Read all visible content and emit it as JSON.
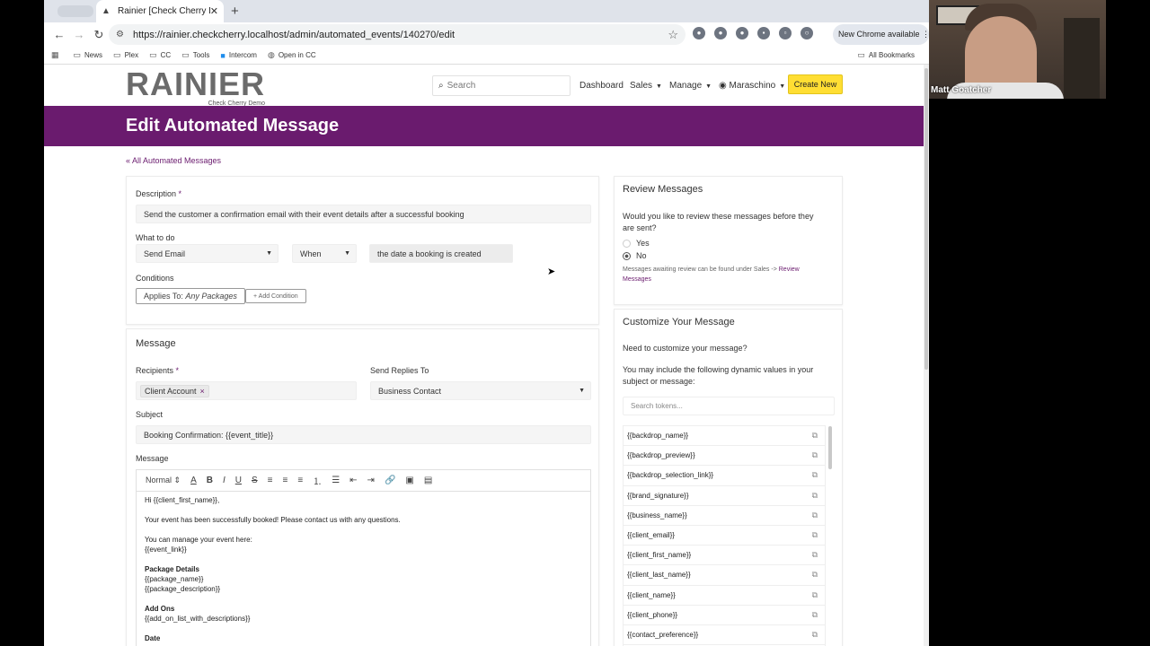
{
  "browser": {
    "tab_ghost": "",
    "tab_title": "Rainier [Check Cherry Demo]",
    "url": "https://rainier.checkcherry.localhost/admin/automated_events/140270/edit",
    "new_chrome": "New Chrome available",
    "bookmarks": [
      "News",
      "Plex",
      "CC",
      "Tools",
      "Intercom",
      "Open in CC"
    ],
    "all_bookmarks": "All Bookmarks"
  },
  "header": {
    "logo": "RAINIER",
    "logo_sub": "Check Cherry Demo",
    "search_placeholder": "Search",
    "nav": {
      "dashboard": "Dashboard",
      "sales": "Sales",
      "manage": "Manage",
      "account": "Maraschino"
    },
    "create_new": "Create New"
  },
  "banner": {
    "title": "Edit Automated Message"
  },
  "back_link": "« All Automated Messages",
  "form": {
    "description_label": "Description",
    "description_value": "Send the customer a confirmation email with their event details after a successful booking",
    "what_to_do_label": "What to do",
    "action": "Send Email",
    "timing": "When",
    "trigger": "the date a booking is created",
    "conditions_label": "Conditions",
    "applies_to_prefix": "Applies To:",
    "applies_to_value": "Any Packages",
    "add_condition": "+ Add Condition"
  },
  "message": {
    "title": "Message",
    "recipients_label": "Recipients",
    "recipient_tag": "Client Account",
    "replies_label": "Send Replies To",
    "replies_value": "Business Contact",
    "subject_label": "Subject",
    "subject_value": "Booking Confirmation: {{event_title}}",
    "message_label": "Message",
    "format": "Normal",
    "body": {
      "l1": "Hi {{client_first_name}},",
      "l2": "Your event has been successfully booked! Please contact us with any questions.",
      "l3": "You can manage your event here:",
      "l4": "{{event_link}}",
      "l5": "Package Details",
      "l6": "{{package_name}}",
      "l7": "{{package_description}}",
      "l8": "Add Ons",
      "l9": "{{add_on_list_with_descriptions}}",
      "l10": "Date"
    }
  },
  "review": {
    "title": "Review Messages",
    "question": "Would you like to review these messages before they are sent?",
    "yes": "Yes",
    "no": "No",
    "selected": "No",
    "note_prefix": "Messages awaiting review can be found under Sales ->",
    "note_link": "Review Messages"
  },
  "customize": {
    "title": "Customize Your Message",
    "q": "Need to customize your message?",
    "desc": "You may include the following dynamic values in your subject or message:",
    "search_placeholder": "Search tokens...",
    "tokens": [
      "{{backdrop_name}}",
      "{{backdrop_preview}}",
      "{{backdrop_selection_link}}",
      "{{brand_signature}}",
      "{{business_name}}",
      "{{client_email}}",
      "{{client_first_name}}",
      "{{client_last_name}}",
      "{{client_name}}",
      "{{client_phone}}",
      "{{contact_preference}}"
    ]
  },
  "video": {
    "participant": "Matt Goatcher"
  },
  "colors": {
    "brand_purple": "#6a1b6e",
    "create_yellow": "#ffde33"
  }
}
